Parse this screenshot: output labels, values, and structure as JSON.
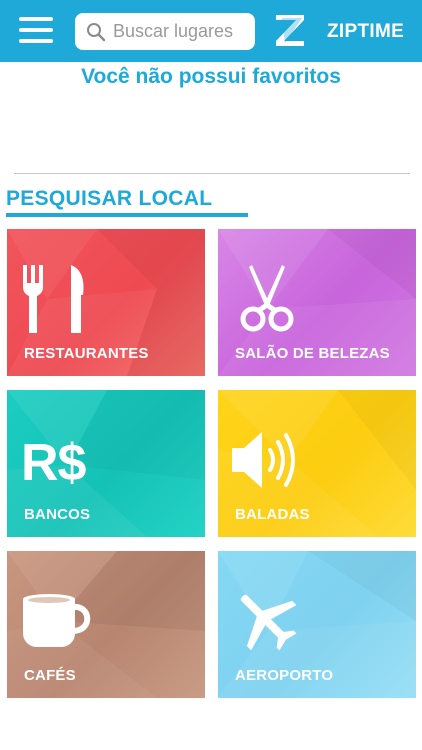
{
  "header": {
    "menu_icon": "hamburger-menu-icon",
    "search": {
      "placeholder": "Buscar lugares",
      "value": "",
      "icon": "search-icon"
    },
    "logo": {
      "icon": "ziptime-z-logo-icon",
      "text": "ZIPTIME"
    }
  },
  "favorites": {
    "empty_message": "Você não possui favoritos"
  },
  "search_section": {
    "title": "PESQUISAR LOCAL"
  },
  "categories": [
    {
      "label": "RESTAURANTES",
      "icon": "fork-knife-icon",
      "color": "#f2555d"
    },
    {
      "label": "SALÃO DE BELEZAS",
      "icon": "scissors-icon",
      "color": "#d07ae2"
    },
    {
      "label": "BANCOS",
      "icon": "currency-real-icon",
      "icon_text": "R$",
      "color": "#1ccdc1"
    },
    {
      "label": "BALADAS",
      "icon": "speaker-volume-icon",
      "color": "#ffd41a"
    },
    {
      "label": "CAFÉS",
      "icon": "coffee-cup-icon",
      "color": "#c29079"
    },
    {
      "label": "AEROPORTO",
      "icon": "airplane-icon",
      "color": "#85d8f3"
    }
  ],
  "colors": {
    "primary": "#1fa9d9",
    "background": "#ffffff",
    "divider": "#c8c8c8"
  }
}
